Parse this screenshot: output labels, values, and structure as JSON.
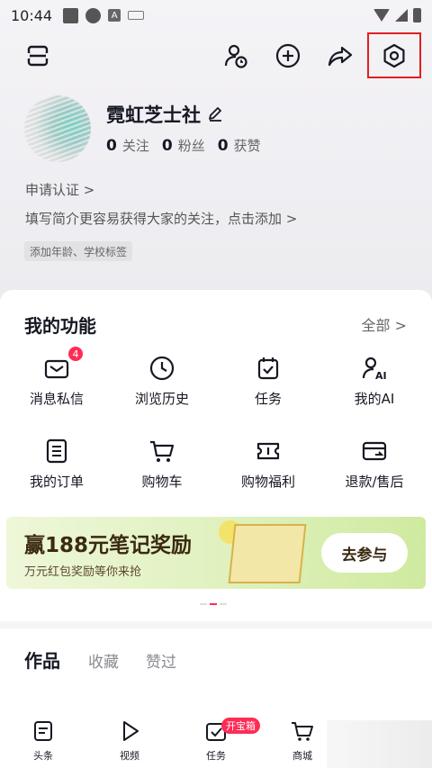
{
  "status_bar": {
    "time": "10:44",
    "a_badge": "A"
  },
  "profile": {
    "nickname": "霓虹芝士社",
    "stats": [
      {
        "value": "0",
        "label": "关注"
      },
      {
        "value": "0",
        "label": "粉丝"
      },
      {
        "value": "0",
        "label": "获赞"
      }
    ],
    "verify_label": "申请认证 >",
    "bio_prompt": "填写简介更容易获得大家的关注，点击添加 >",
    "tag": "添加年龄、学校标签"
  },
  "functions": {
    "title": "我的功能",
    "all_label": "全部 >",
    "items": [
      {
        "label": "消息私信",
        "icon": "message-icon",
        "badge": "4"
      },
      {
        "label": "浏览历史",
        "icon": "clock-icon"
      },
      {
        "label": "任务",
        "icon": "task-icon"
      },
      {
        "label": "我的AI",
        "icon": "ai-user-icon"
      },
      {
        "label": "我的订单",
        "icon": "order-icon"
      },
      {
        "label": "购物车",
        "icon": "cart-icon"
      },
      {
        "label": "购物福利",
        "icon": "coupon-icon"
      },
      {
        "label": "退款/售后",
        "icon": "refund-card-icon"
      }
    ]
  },
  "banner": {
    "title": "赢188元笔记奖励",
    "subtitle": "万元红包奖励等你来抢",
    "button": "去参与"
  },
  "works_tabs": [
    "作品",
    "收藏",
    "赞过"
  ],
  "bottom_nav": {
    "items": [
      {
        "label": "头条",
        "icon": "news-icon"
      },
      {
        "label": "视频",
        "icon": "play-icon"
      },
      {
        "label": "任务",
        "icon": "task-icon"
      },
      {
        "label": "商城",
        "icon": "cart-icon"
      }
    ],
    "task_badge": "开宝箱"
  },
  "colors": {
    "accent": "#fe2c55",
    "highlight": "#e02020",
    "text": "#161823"
  }
}
